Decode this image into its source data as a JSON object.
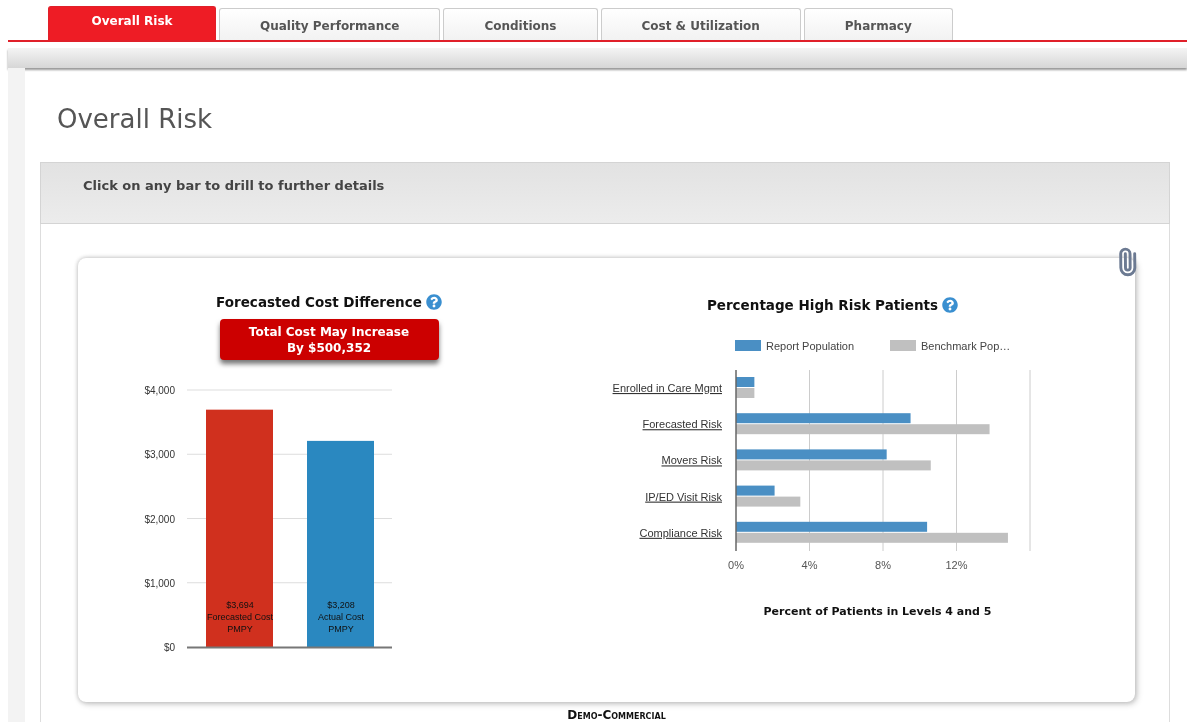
{
  "tabs": [
    {
      "label": "Overall Risk",
      "selected": true
    },
    {
      "label": "Quality Performance",
      "selected": false
    },
    {
      "label": "Conditions",
      "selected": false
    },
    {
      "label": "Cost & Utilization",
      "selected": false
    },
    {
      "label": "Pharmacy",
      "selected": false
    }
  ],
  "page_title": "Overall Risk",
  "instruction": "Click on any bar to drill to further details",
  "cost_chart": {
    "title": "Forecasted Cost Difference",
    "alert": [
      "Total Cost May Increase",
      "By $500,352"
    ],
    "bars": [
      {
        "color": "#d0301e",
        "labels": [
          "$3,694",
          "Forecasted Cost",
          "PMPY"
        ]
      },
      {
        "color": "#2a88c0",
        "labels": [
          "$3,208",
          "Actual Cost",
          "PMPY"
        ]
      }
    ],
    "chart_data": {
      "type": "bar",
      "grid": true,
      "series": [
        {
          "values": [
            3694,
            3208
          ]
        }
      ],
      "ylim": [
        0,
        4000
      ],
      "yticks": [
        {
          "value": 0,
          "label": "$0"
        },
        {
          "value": 1000,
          "label": "$1,000"
        },
        {
          "value": 2000,
          "label": "$2,000"
        },
        {
          "value": 3000,
          "label": "$3,000"
        },
        {
          "value": 4000,
          "label": "$4,000"
        }
      ]
    }
  },
  "risk_chart": {
    "title": "Percentage High Risk Patients",
    "chart_data": {
      "type": "bar",
      "orientation": "horizontal",
      "grid": true,
      "legend": true,
      "xlabel": "Percent of Patients in Levels 4 and 5",
      "categories": [
        "Enrolled in Care Mgmt",
        "Forecasted Risk",
        "Movers Risk",
        "IP/ED Visit Risk",
        "Compliance Risk"
      ],
      "series": [
        {
          "name": "Report Population",
          "color": "#4a8fc4",
          "values": [
            1.0,
            9.5,
            8.2,
            2.1,
            10.4
          ]
        },
        {
          "name": "Benchmark Pop…",
          "color": "#c0c0c0",
          "values": [
            1.0,
            13.8,
            10.6,
            3.5,
            14.8
          ]
        }
      ],
      "xlim": [
        0,
        16
      ],
      "xticks": [
        {
          "value": 0,
          "label": "0%"
        },
        {
          "value": 4,
          "label": "4%"
        },
        {
          "value": 8,
          "label": "8%"
        },
        {
          "value": 12,
          "label": "12%"
        }
      ]
    }
  },
  "footer": "Demo-Commercial"
}
